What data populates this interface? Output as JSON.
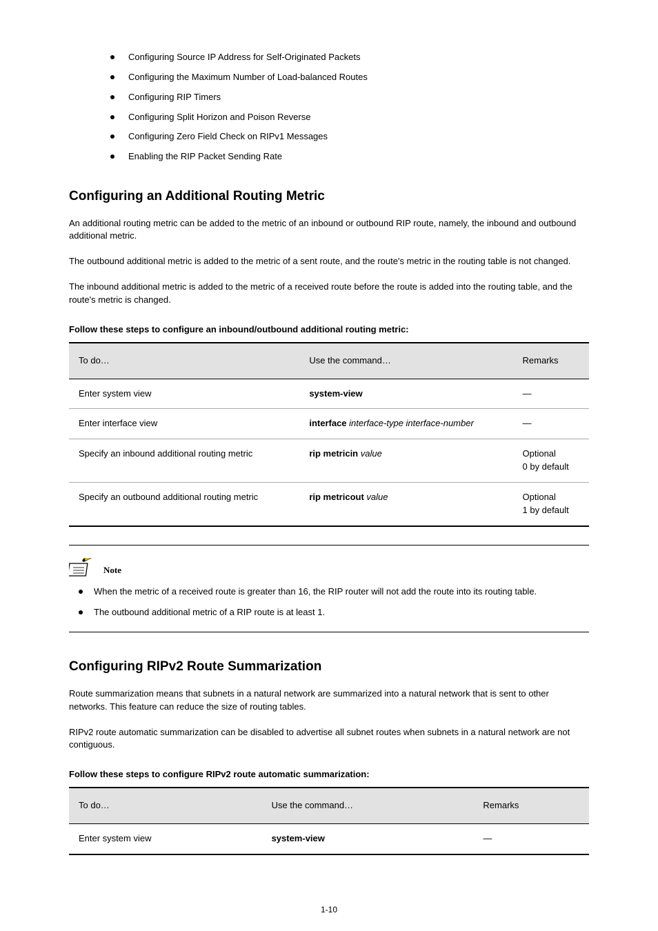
{
  "bullets": [
    "Configuring Source IP Address for Self-Originated Packets",
    "Configuring the Maximum Number of Load-balanced Routes",
    "Configuring RIP Timers",
    "Configuring Split Horizon and Poison Reverse",
    "Configuring Zero Field Check on RIPv1 Messages",
    "Enabling the RIP Packet Sending Rate"
  ],
  "section1": {
    "heading": "Configuring an Additional Routing Metric",
    "paragraphs": [
      "An additional routing metric can be added to the metric of an inbound or outbound RIP route, namely, the inbound and outbound additional metric.",
      "The outbound additional metric is added to the metric of a sent route, and the route's metric in the routing table is not changed.",
      "The inbound additional metric is added to the metric of a received route before the route is added into the routing table, and the route's metric is changed."
    ],
    "table_caption": "Follow these steps to configure an inbound/outbound additional routing metric:",
    "table": {
      "headers": [
        "To do…",
        "Use the command…",
        "Remarks"
      ],
      "rows": [
        {
          "col0": "Enter system view",
          "col1": "system-view",
          "col2": "—",
          "col1_bold": true
        },
        {
          "col0": "Enter interface view",
          "col1": "interface interface-type interface-number",
          "col1_bold_first_word": true,
          "col2": "—"
        },
        {
          "col0": "Specify an inbound additional routing metric",
          "col1": "rip metricin value",
          "col1_bold_first_two_words": true,
          "col2": "Optional\n0 by default"
        },
        {
          "col0": "Specify an outbound additional routing metric",
          "col1": "rip metricout value",
          "col1_bold_first_two_words": true,
          "col2": "Optional\n1 by default"
        }
      ]
    }
  },
  "note": {
    "label": "Note",
    "items": [
      "When the metric of a received route is greater than 16, the RIP router will not add the route into its routing table.",
      "The outbound additional metric of a RIP route is at least 1."
    ]
  },
  "section2": {
    "heading": "Configuring RIPv2 Route Summarization",
    "paragraphs": [
      "Route summarization means that subnets in a natural network are summarized into a natural network that is sent to other networks. This feature can reduce the size of routing tables.",
      "RIPv2 route automatic summarization can be disabled to advertise all subnet routes when subnets in a natural network are not contiguous."
    ],
    "table_caption": "Follow these steps to configure RIPv2 route automatic summarization:",
    "table": {
      "headers": [
        "To do…",
        "Use the command…",
        "Remarks"
      ],
      "rows": [
        {
          "col0": "Enter system view",
          "col1": "system-view",
          "col1_bold": true,
          "col2": "—"
        }
      ]
    }
  },
  "page_number": "1-10"
}
